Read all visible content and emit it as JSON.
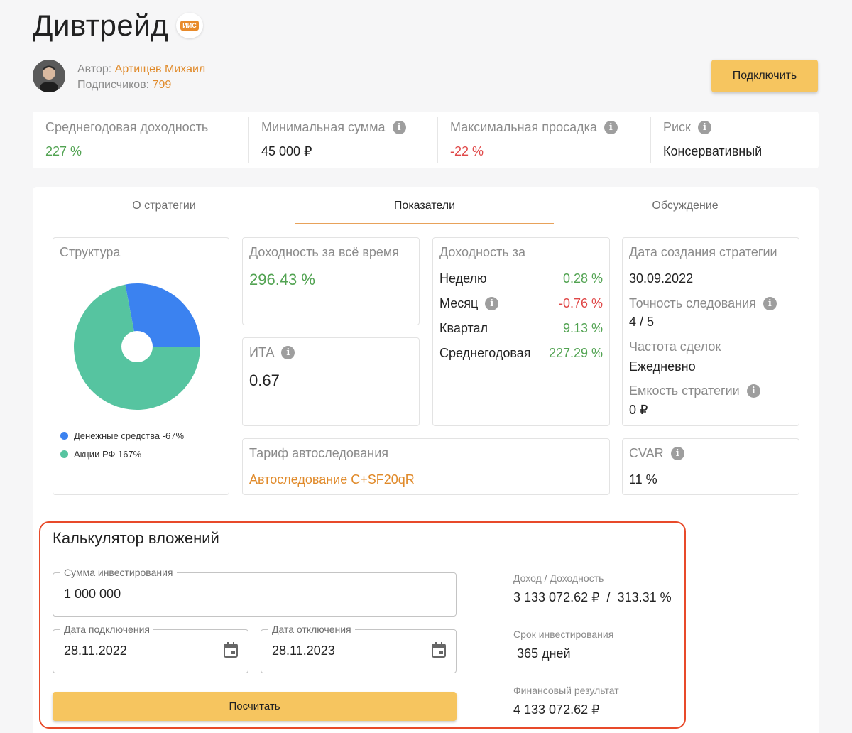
{
  "header": {
    "title": "Дивтрейд",
    "badge": "ИИС",
    "author_label": "Автор:",
    "author_name": "Артищев Михаил",
    "subscribers_label": "Подписчиков:",
    "subscribers_count": "799",
    "connect_label": "Подключить"
  },
  "metrics": [
    {
      "label": "Среднегодовая доходность",
      "value": "227 %",
      "color": "#52a352"
    },
    {
      "label": "Минимальная сумма",
      "value": "45 000 ₽",
      "color": "#222222"
    },
    {
      "label": "Максимальная просадка",
      "value": "-22 %",
      "color": "#e04848"
    },
    {
      "label": "Риск",
      "value": "Консервативный",
      "color": "#222222"
    }
  ],
  "tabs": [
    {
      "label": "О стратегии"
    },
    {
      "label": "Показатели"
    },
    {
      "label": "Обсуждение"
    }
  ],
  "structure": {
    "title": "Структура",
    "legend": [
      {
        "label": "Денежные средства -67%",
        "color": "#3b82f0"
      },
      {
        "label": "Акции РФ 167%",
        "color": "#56c4a0"
      }
    ]
  },
  "chart_data": {
    "type": "pie",
    "categories": [
      "Денежные средства",
      "Акции РФ"
    ],
    "values": [
      -67,
      167
    ],
    "display_share": [
      0.28,
      0.72
    ],
    "colors": [
      "#3b82f0",
      "#56c4a0"
    ]
  },
  "total_return": {
    "title": "Доходность за всё время",
    "value": "296.43 %"
  },
  "ita": {
    "title": "ИТА",
    "value": "0.67"
  },
  "period_returns": {
    "title": "Доходность за",
    "rows": [
      {
        "name": "Неделю",
        "value": "0.28 %",
        "color": "#52a352"
      },
      {
        "name": "Месяц",
        "value": "-0.76 %",
        "color": "#e04848"
      },
      {
        "name": "Квартал",
        "value": "9.13 %",
        "color": "#52a352"
      },
      {
        "name": "Среднегодовая",
        "value": "227.29 %",
        "color": "#52a352"
      }
    ]
  },
  "strategy_info": {
    "created_label": "Дата создания стратегии",
    "created_value": "30.09.2022",
    "accuracy_label": "Точность следования",
    "accuracy_value": "4 / 5",
    "frequency_label": "Частота сделок",
    "frequency_value": "Ежедневно",
    "capacity_label": "Емкость стратегии",
    "capacity_value": "0 ₽"
  },
  "tariff": {
    "title": "Тариф автоследования",
    "value": "Автоследование С+SF20qR"
  },
  "cvar": {
    "title": "CVAR",
    "value": "11 %"
  },
  "calculator": {
    "title": "Калькулятор вложений",
    "amount_label": "Сумма инвестирования",
    "amount_value": "1 000 000",
    "start_label": "Дата подключения",
    "start_value": "28.11.2022",
    "end_label": "Дата отключения",
    "end_value": "28.11.2023",
    "button_label": "Посчитать",
    "income_label": "Доход / Доходность",
    "income_value": "3 133 072.62 ₽  /  313.31 %",
    "term_label": "Срок инвестирования",
    "term_value": "365 дней",
    "result_label": "Финансовый результат",
    "result_value": "4 133 072.62 ₽"
  }
}
